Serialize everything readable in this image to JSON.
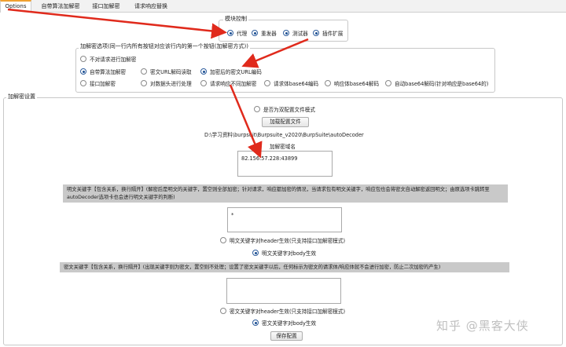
{
  "tabs": [
    "Options",
    "自带算法加解密",
    "接口加解密",
    "请求响应替换"
  ],
  "module_control": {
    "title": "模块控制",
    "options": [
      {
        "label": "代理",
        "checked": true
      },
      {
        "label": "重发器",
        "checked": true
      },
      {
        "label": "测试器",
        "checked": true
      },
      {
        "label": "插件扩展",
        "checked": true
      }
    ]
  },
  "decrypt_options": {
    "title": "加解密选项(同一行内所有按钮对应该行内的第一个按钮(加解密方式))",
    "rows": [
      [
        {
          "label": "不对请求进行加解密",
          "checked": false
        }
      ],
      [
        {
          "label": "自带算法加解密",
          "checked": true
        },
        {
          "label": "密文URL解码读取",
          "checked": false
        },
        {
          "label": "加密后的密文URL编码",
          "checked": true
        }
      ],
      [
        {
          "label": "接口加解密",
          "checked": false
        },
        {
          "label": "对数据头进行处理",
          "checked": false
        },
        {
          "label": "请求响应不同加解密",
          "checked": false
        },
        {
          "label": "请求体base64编码",
          "checked": false
        },
        {
          "label": "响应体base64解码",
          "checked": false
        },
        {
          "label": "自动base64解码(针对响应是base64的)",
          "checked": false
        }
      ]
    ]
  },
  "settings": {
    "title": "加解密设置",
    "dual_config_label": "是否为双配置文件模式",
    "load_config_button": "加载配置文件",
    "config_path": "D:\\学习资料\\burpsuit\\Burpsuite_v2020\\BurpSuite\\autoDecoder",
    "domain_label": "加解密域名",
    "domain_value": "82.156.57.228:43899",
    "plain_keyword_note": "明文关键字【包含关系，换行隔开】(解密后是明文的关键字，置空则全部加密；针对请求，响应都加密的情况，当请求包有明文关键字，响应包也会将密文自动解密返回明文；由原选项卡跳转至autoDecoder选项卡也会进行明文关键字的判断)",
    "plain_keyword_value": "*",
    "plain_header_option": "明文关键字对header生效(只支持接口加解密模式)",
    "plain_body_option": "明文关键字对body生效",
    "cipher_keyword_note": "密文关键字【包含关系，换行隔开】(出现关键字则为密文，置空则不处理；设置了密文关键字以后，任何标示为密文的请求体/响应体就不会进行加密，防止二次加密的产生)",
    "cipher_keyword_value": "",
    "cipher_header_option": "密文关键字对header生效(只支持接口加解密模式)",
    "cipher_body_option": "密文关键字对body生效",
    "save_button": "保存配置"
  },
  "watermark": "知乎 @黑客大侠",
  "colors": {
    "arrow": "#e02a1c",
    "tab_accent": "#f0a030"
  }
}
